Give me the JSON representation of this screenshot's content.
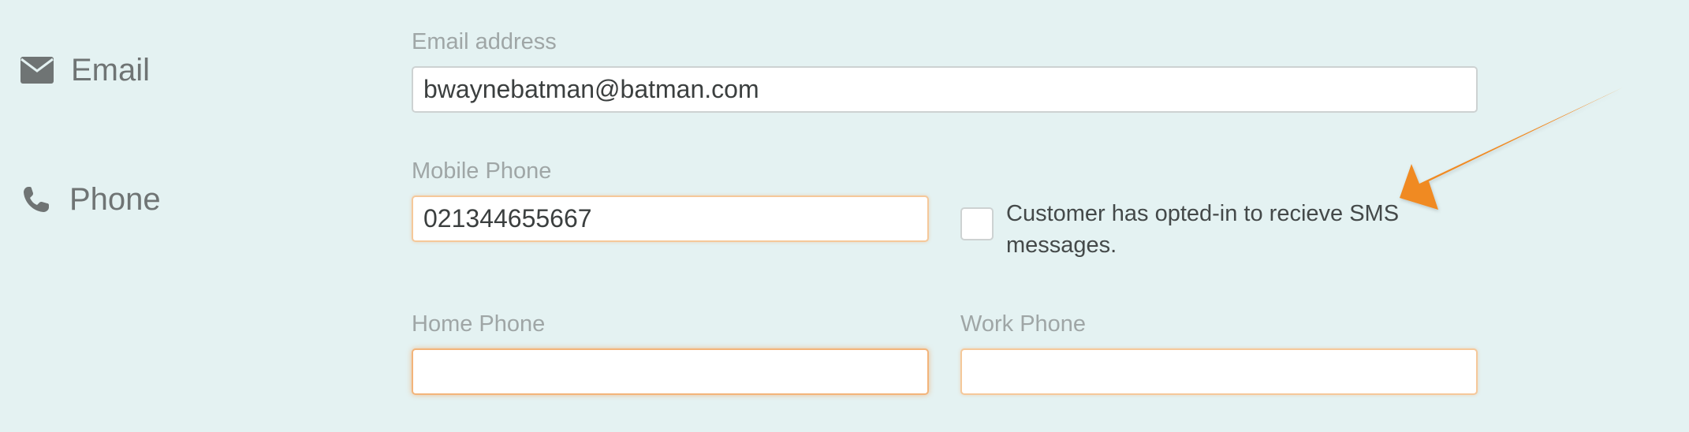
{
  "colors": {
    "background": "#e4f2f2",
    "accent_orange": "#f08a24",
    "input_border_highlight": "#f5c89a"
  },
  "email_section": {
    "icon": "envelope-icon",
    "label": "Email",
    "field_label": "Email address",
    "email_value": "bwaynebatman@batman.com"
  },
  "phone_section": {
    "icon": "phone-icon",
    "label": "Phone",
    "mobile": {
      "label": "Mobile Phone",
      "value": "021344655667"
    },
    "sms_opt_in": {
      "label": "Customer has opted-in to recieve SMS messages.",
      "checked": false
    },
    "home": {
      "label": "Home Phone",
      "value": ""
    },
    "work": {
      "label": "Work Phone",
      "value": ""
    }
  },
  "annotation": {
    "icon": "arrow-pointer-icon"
  }
}
